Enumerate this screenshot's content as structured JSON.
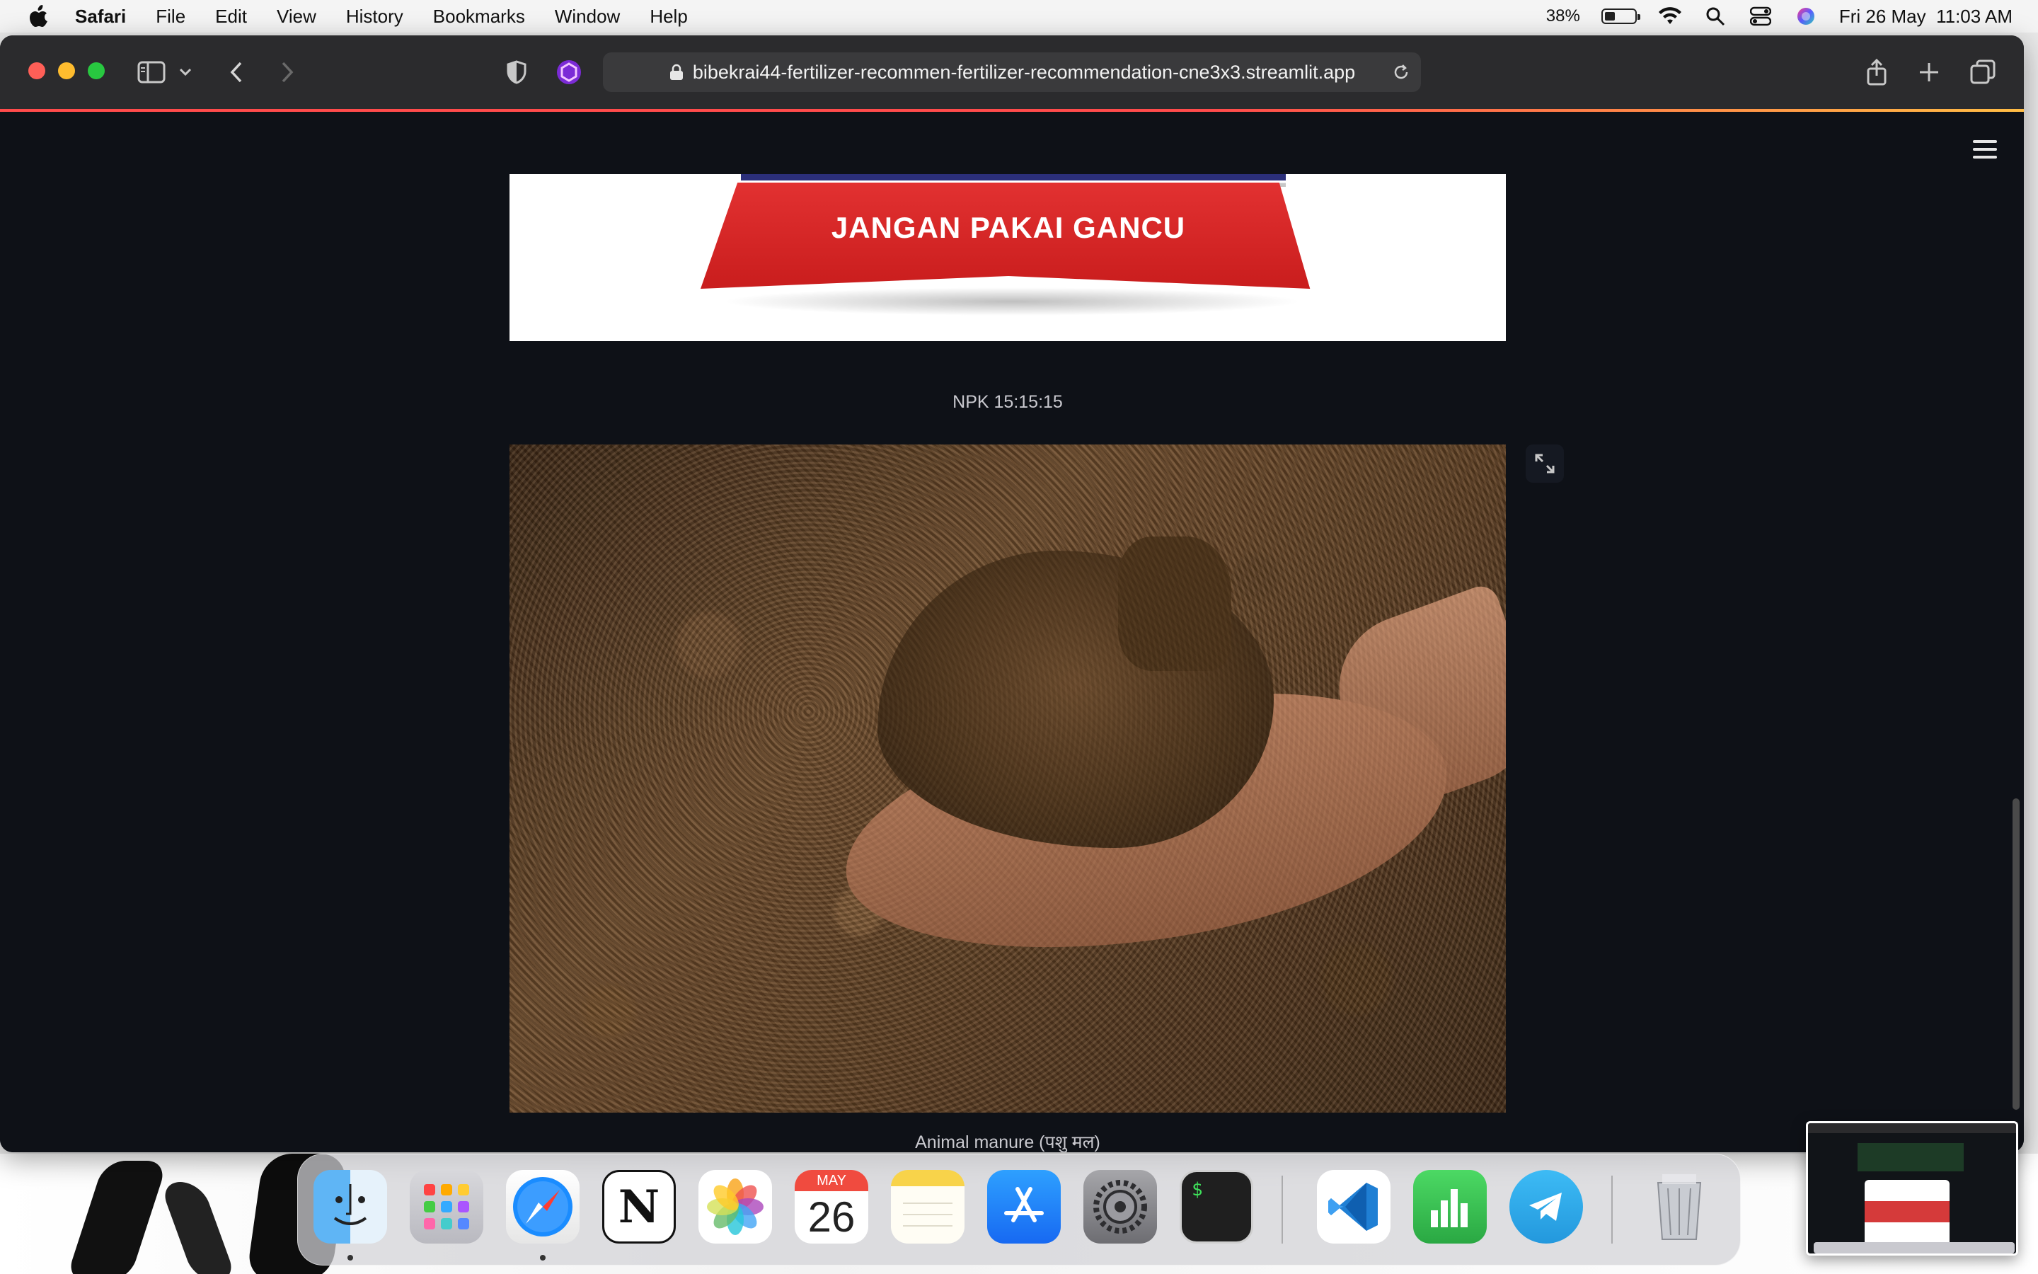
{
  "menubar": {
    "app_name": "Safari",
    "items": [
      "File",
      "Edit",
      "View",
      "History",
      "Bookmarks",
      "Window",
      "Help"
    ],
    "battery_percent": "38%",
    "battery_level": 0.38,
    "datetime": "Fri 26 May  11:03 AM"
  },
  "browser": {
    "url": "bibekrai44-fertilizer-recommen-fertilizer-recommendation-cne3x3.streamlit.app"
  },
  "page": {
    "image1": {
      "banner_text": "JANGAN PAKAI GANCU",
      "caption": "NPK 15:15:15"
    },
    "image2": {
      "caption": "Animal manure (पशु मल)"
    }
  },
  "dock": {
    "apps": [
      {
        "name": "Finder",
        "icon": "finder-icon"
      },
      {
        "name": "Launchpad",
        "icon": "launchpad-icon"
      },
      {
        "name": "Safari",
        "icon": "safari-icon"
      },
      {
        "name": "Notion",
        "icon": "notion-icon"
      },
      {
        "name": "Photos",
        "icon": "photos-icon"
      },
      {
        "name": "Calendar",
        "icon": "calendar-icon"
      },
      {
        "name": "Notes",
        "icon": "notes-icon"
      },
      {
        "name": "App Store",
        "icon": "app-store-icon"
      },
      {
        "name": "System Settings",
        "icon": "settings-icon"
      },
      {
        "name": "Terminal",
        "icon": "terminal-icon"
      },
      {
        "name": "Visual Studio Code",
        "icon": "vscode-icon"
      },
      {
        "name": "Numbers",
        "icon": "numbers-icon"
      },
      {
        "name": "Telegram",
        "icon": "telegram-icon"
      },
      {
        "name": "Trash",
        "icon": "trash-icon"
      }
    ],
    "calendar_month": "MAY",
    "calendar_day": "26",
    "notion_glyph": "N",
    "terminal_glyph": "$"
  }
}
